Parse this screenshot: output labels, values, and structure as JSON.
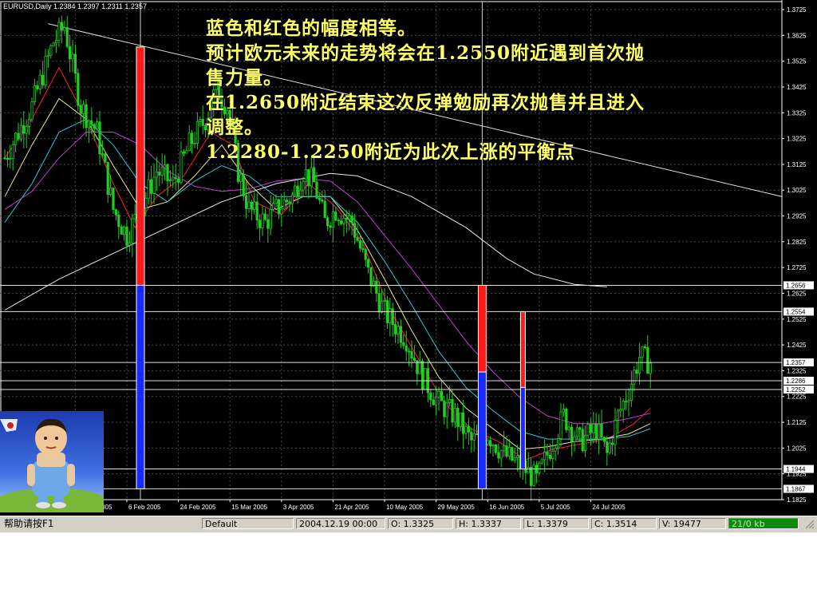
{
  "window": {
    "symbol_header": "EURUSD,Daily  1.2384 1.2397 1.2311 1.2357"
  },
  "annotations": [
    "蓝色和红色的幅度相等。",
    "预计欧元未来的走势将会在1.2550附近遇到首次抛",
    "售力量。",
    "在1.2650附近结束这次反弹勉励再次抛售并且进入",
    "调整。",
    "1.2280-1.2250附近为此次上涨的平衡点"
  ],
  "status_bar": {
    "help": "帮助请按F1",
    "profile": "Default",
    "time": "2004.12.19 00:00",
    "open": "O: 1.3325",
    "high": "H: 1.3337",
    "low": "L: 1.3379",
    "close": "C: 1.3514",
    "volume": "V: 19477",
    "traffic": "21/0 kb"
  },
  "colors": {
    "background": "#000000",
    "grid": "#4a4a4a",
    "candle": "#22cc22",
    "ma_red": "#ff2020",
    "ma_yellow": "#e8e890",
    "ma_cyan": "#30c8d8",
    "ma_magenta": "#c040d0",
    "ma_white": "#e8e8e8",
    "bar_red": "#ff1a1a",
    "bar_blue": "#1a2aff",
    "text": "#ffffff",
    "annotation": "#ffff66"
  },
  "chart_data": {
    "type": "candlestick",
    "title": "EURUSD,Daily",
    "ylim": [
      1.1825,
      1.3725
    ],
    "y_ticks": [
      "1.3725",
      "1.3625",
      "1.3525",
      "1.3425",
      "1.3325",
      "1.3225",
      "1.3125",
      "1.3025",
      "1.2925",
      "1.2825",
      "1.2725",
      "1.2625",
      "1.2525",
      "1.2425",
      "1.2325",
      "1.2225",
      "1.2125",
      "1.2025",
      "1.1925",
      "1.1825"
    ],
    "y_ticks_values": [
      1.3725,
      1.3625,
      1.3525,
      1.3425,
      1.3325,
      1.3225,
      1.3125,
      1.3025,
      1.2925,
      1.2825,
      1.2725,
      1.2625,
      1.2525,
      1.2425,
      1.2325,
      1.2225,
      1.2125,
      1.2025,
      1.1925,
      1.1825
    ],
    "x_tick_labels": [
      "18 Jan 2005",
      "6 Feb 2005",
      "24 Feb 2005",
      "15 Mar 2005",
      "3 Apr 2005",
      "21 Apr 2005",
      "10 May 2005",
      "29 May 2005",
      "16 Jun 2005",
      "5 Jul 2005",
      "24 Jul 2005"
    ],
    "x_tick_bar_index": [
      26,
      45,
      64,
      83,
      102,
      121,
      140,
      159,
      178,
      197,
      216
    ],
    "total_bars": 240,
    "price_path": [
      [
        0,
        1.315
      ],
      [
        10,
        1.335
      ],
      [
        18,
        1.36
      ],
      [
        22,
        1.366
      ],
      [
        28,
        1.335
      ],
      [
        34,
        1.325
      ],
      [
        40,
        1.295
      ],
      [
        45,
        1.285
      ],
      [
        50,
        1.295
      ],
      [
        56,
        1.31
      ],
      [
        62,
        1.305
      ],
      [
        68,
        1.32
      ],
      [
        74,
        1.33
      ],
      [
        78,
        1.342
      ],
      [
        82,
        1.335
      ],
      [
        86,
        1.31
      ],
      [
        90,
        1.295
      ],
      [
        96,
        1.29
      ],
      [
        100,
        1.295
      ],
      [
        106,
        1.3
      ],
      [
        110,
        1.31
      ],
      [
        114,
        1.305
      ],
      [
        118,
        1.29
      ],
      [
        122,
        1.295
      ],
      [
        128,
        1.29
      ],
      [
        134,
        1.27
      ],
      [
        140,
        1.255
      ],
      [
        148,
        1.245
      ],
      [
        154,
        1.23
      ],
      [
        160,
        1.22
      ],
      [
        166,
        1.215
      ],
      [
        172,
        1.205
      ],
      [
        178,
        1.208
      ],
      [
        184,
        1.2
      ],
      [
        190,
        1.196
      ],
      [
        196,
        1.19
      ],
      [
        200,
        1.2
      ],
      [
        206,
        1.215
      ],
      [
        212,
        1.205
      ],
      [
        218,
        1.21
      ],
      [
        222,
        1.2
      ],
      [
        226,
        1.215
      ],
      [
        230,
        1.225
      ],
      [
        234,
        1.238
      ],
      [
        238,
        1.2357
      ]
    ],
    "moving_averages": [
      {
        "color": "#ff2020",
        "points": [
          [
            0,
            1.315
          ],
          [
            10,
            1.33
          ],
          [
            20,
            1.35
          ],
          [
            30,
            1.33
          ],
          [
            40,
            1.305
          ],
          [
            48,
            1.288
          ],
          [
            56,
            1.3
          ],
          [
            66,
            1.308
          ],
          [
            76,
            1.325
          ],
          [
            84,
            1.32
          ],
          [
            92,
            1.298
          ],
          [
            102,
            1.293
          ],
          [
            112,
            1.305
          ],
          [
            122,
            1.296
          ],
          [
            132,
            1.282
          ],
          [
            142,
            1.256
          ],
          [
            152,
            1.238
          ],
          [
            162,
            1.22
          ],
          [
            172,
            1.21
          ],
          [
            182,
            1.205
          ],
          [
            192,
            1.198
          ],
          [
            202,
            1.202
          ],
          [
            212,
            1.204
          ],
          [
            222,
            1.206
          ],
          [
            232,
            1.212
          ],
          [
            238,
            1.218
          ]
        ]
      },
      {
        "color": "#e8e890",
        "points": [
          [
            0,
            1.3
          ],
          [
            10,
            1.32
          ],
          [
            20,
            1.338
          ],
          [
            30,
            1.33
          ],
          [
            40,
            1.312
          ],
          [
            50,
            1.295
          ],
          [
            60,
            1.298
          ],
          [
            70,
            1.308
          ],
          [
            80,
            1.32
          ],
          [
            90,
            1.305
          ],
          [
            100,
            1.295
          ],
          [
            110,
            1.3
          ],
          [
            120,
            1.3
          ],
          [
            130,
            1.287
          ],
          [
            140,
            1.268
          ],
          [
            150,
            1.248
          ],
          [
            160,
            1.23
          ],
          [
            170,
            1.218
          ],
          [
            180,
            1.21
          ],
          [
            190,
            1.202
          ],
          [
            200,
            1.203
          ],
          [
            210,
            1.205
          ],
          [
            220,
            1.206
          ],
          [
            230,
            1.208
          ],
          [
            238,
            1.212
          ]
        ]
      },
      {
        "color": "#30c8d8",
        "points": [
          [
            0,
            1.29
          ],
          [
            10,
            1.305
          ],
          [
            20,
            1.325
          ],
          [
            30,
            1.33
          ],
          [
            40,
            1.32
          ],
          [
            50,
            1.305
          ],
          [
            60,
            1.298
          ],
          [
            70,
            1.306
          ],
          [
            80,
            1.312
          ],
          [
            90,
            1.308
          ],
          [
            100,
            1.3
          ],
          [
            110,
            1.3
          ],
          [
            120,
            1.3
          ],
          [
            130,
            1.29
          ],
          [
            140,
            1.275
          ],
          [
            150,
            1.258
          ],
          [
            160,
            1.24
          ],
          [
            170,
            1.226
          ],
          [
            180,
            1.217
          ],
          [
            190,
            1.209
          ],
          [
            200,
            1.206
          ],
          [
            210,
            1.206
          ],
          [
            220,
            1.206
          ],
          [
            230,
            1.207
          ],
          [
            238,
            1.21
          ]
        ]
      },
      {
        "color": "#c040d0",
        "points": [
          [
            0,
            1.295
          ],
          [
            10,
            1.302
          ],
          [
            20,
            1.315
          ],
          [
            30,
            1.325
          ],
          [
            40,
            1.325
          ],
          [
            50,
            1.32
          ],
          [
            60,
            1.31
          ],
          [
            70,
            1.304
          ],
          [
            80,
            1.302
          ],
          [
            90,
            1.303
          ],
          [
            100,
            1.306
          ],
          [
            110,
            1.307
          ],
          [
            120,
            1.306
          ],
          [
            130,
            1.298
          ],
          [
            140,
            1.285
          ],
          [
            150,
            1.272
          ],
          [
            160,
            1.258
          ],
          [
            170,
            1.244
          ],
          [
            180,
            1.232
          ],
          [
            190,
            1.222
          ],
          [
            200,
            1.215
          ],
          [
            210,
            1.212
          ],
          [
            220,
            1.212
          ],
          [
            230,
            1.214
          ],
          [
            238,
            1.216
          ]
        ]
      },
      {
        "color": "#e8e8e8",
        "points": [
          [
            0,
            1.256
          ],
          [
            20,
            1.268
          ],
          [
            40,
            1.278
          ],
          [
            60,
            1.288
          ],
          [
            80,
            1.298
          ],
          [
            100,
            1.305
          ],
          [
            120,
            1.309
          ],
          [
            130,
            1.308
          ],
          [
            150,
            1.3
          ],
          [
            170,
            1.288
          ],
          [
            185,
            1.276
          ],
          [
            195,
            1.27
          ],
          [
            210,
            1.266
          ],
          [
            222,
            1.265
          ]
        ]
      }
    ],
    "trend_line": {
      "from": [
        16,
        1.367
      ],
      "to": [
        240,
        1.3
      ]
    },
    "horizontal_levels": [
      1.2656,
      1.2554,
      1.2357,
      1.2286,
      1.2252,
      1.1944,
      1.1867
    ],
    "level_labels": [
      "1.2656",
      "1.2554",
      "1.2357",
      "1.2286",
      "1.2252",
      "1.1944",
      "1.1867"
    ],
    "vertical_lines_at_bar": [
      50,
      176
    ],
    "measure_bars": [
      {
        "bar": 50,
        "red_top": 1.358,
        "split": 1.2656,
        "blue_bottom": 1.1867
      },
      {
        "bar": 176,
        "red_top": 1.2656,
        "split": 1.232,
        "blue_bottom": 1.1867
      },
      {
        "bar": 191,
        "red_top": 1.2554,
        "split": 1.226,
        "blue_bottom": 1.1944
      }
    ]
  }
}
